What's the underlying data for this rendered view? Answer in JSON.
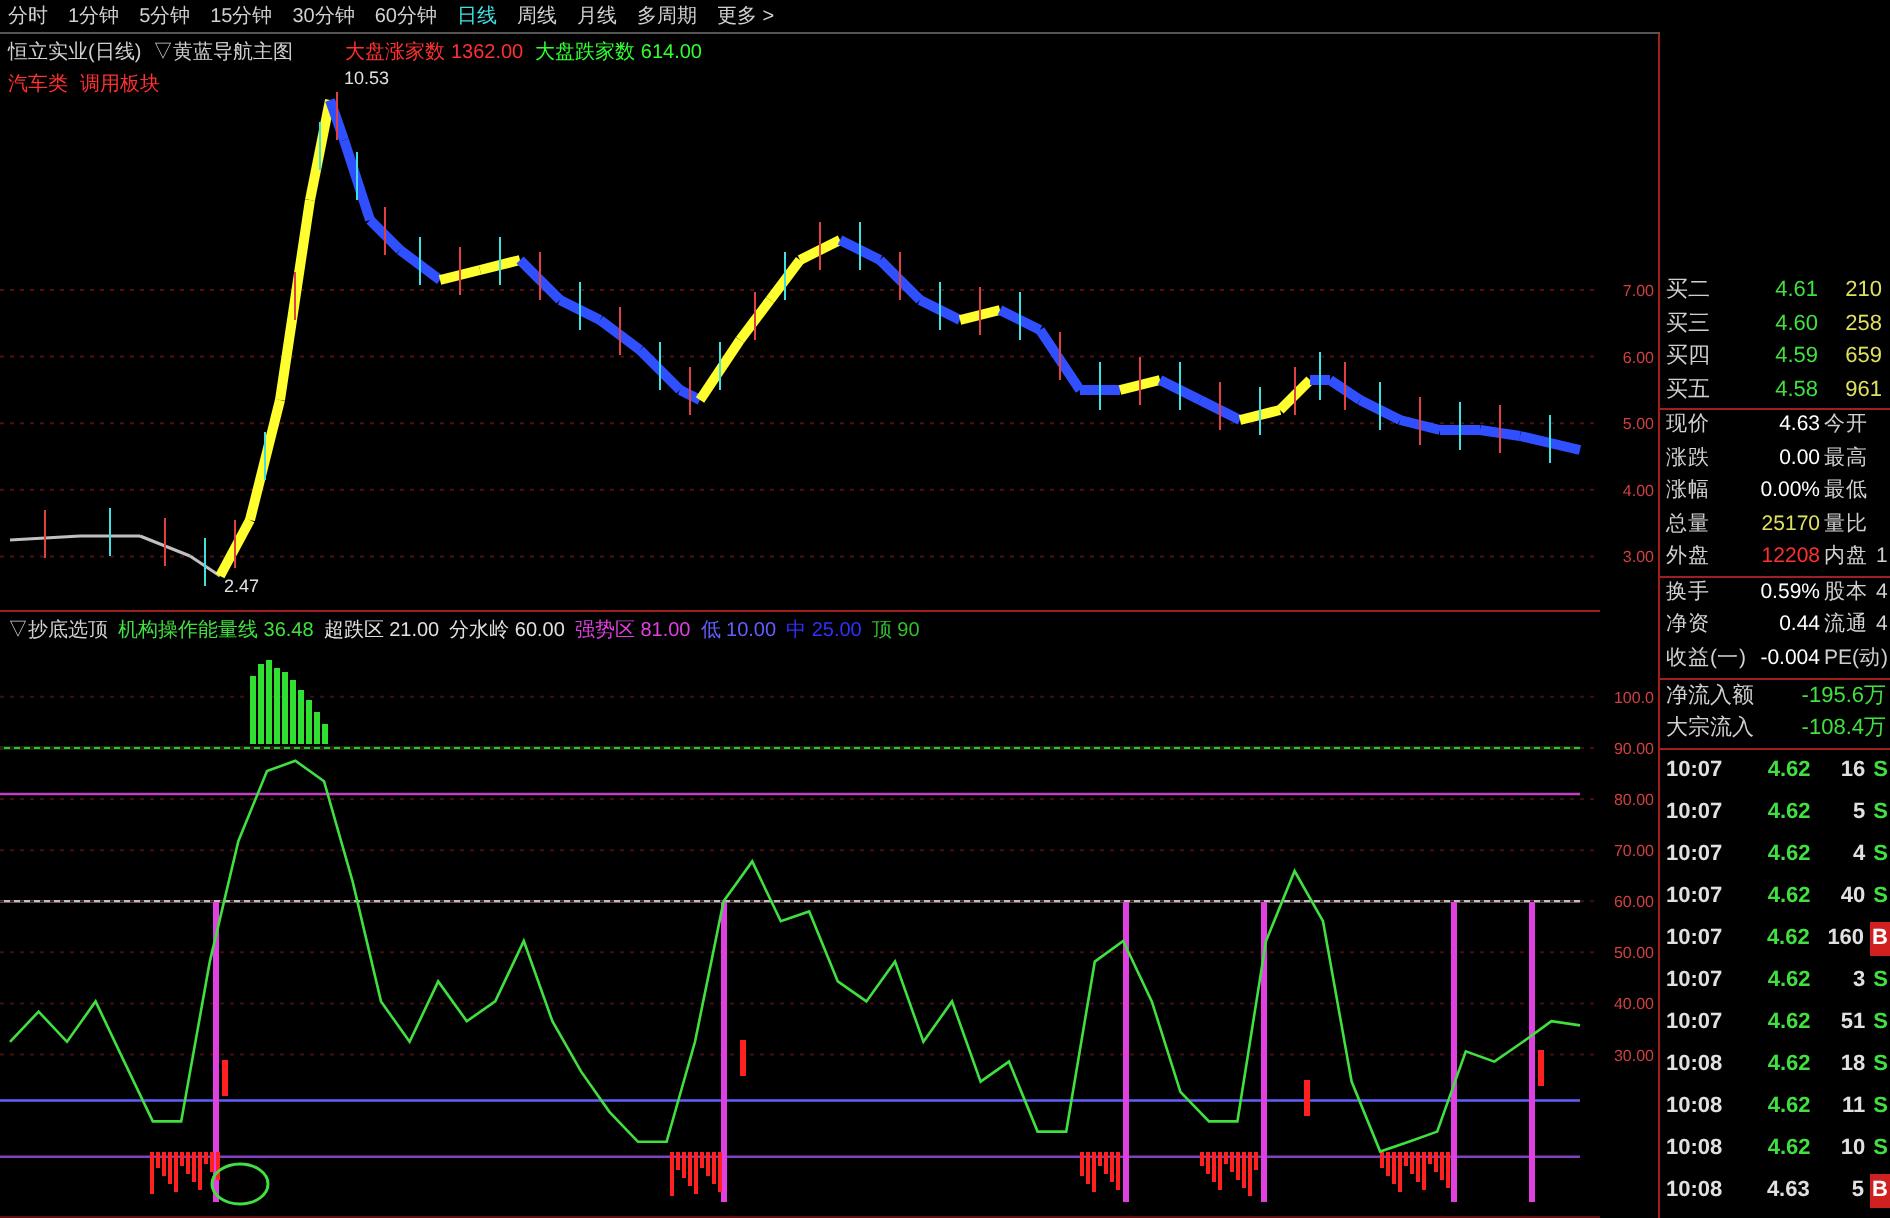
{
  "menu": [
    {
      "label": "分时",
      "selected": false
    },
    {
      "label": "1分钟",
      "selected": false
    },
    {
      "label": "5分钟",
      "selected": false
    },
    {
      "label": "15分钟",
      "selected": false
    },
    {
      "label": "30分钟",
      "selected": false
    },
    {
      "label": "60分钟",
      "selected": false
    },
    {
      "label": "日线",
      "selected": true
    },
    {
      "label": "周线",
      "selected": false
    },
    {
      "label": "月线",
      "selected": false
    },
    {
      "label": "多周期",
      "selected": false
    },
    {
      "label": "更多 >",
      "selected": false
    }
  ],
  "price_panel": {
    "title": "恒立实业(日线)",
    "indicator": "▽黄蓝导航主图",
    "legend": [
      {
        "label": "大盘涨家数",
        "value": "1362.00",
        "color": "#ff3030"
      },
      {
        "label": "大盘跌家数",
        "value": "614.00",
        "color": "#30ff30"
      }
    ],
    "subtitle": [
      "汽车类",
      "调用板块"
    ],
    "annotations": [
      "10.53",
      "2.47"
    ],
    "axis": [
      "7.00",
      "6.00",
      "5.00",
      "4.00",
      "3.00"
    ]
  },
  "indicator_panel": {
    "title": "▽抄底选顶",
    "line_value": "36.48",
    "lines": [
      {
        "label": "超跌区",
        "value": "21.00",
        "color": "#e0e0e0"
      },
      {
        "label": "分水岭",
        "value": "60.00",
        "color": "#e0e0e0"
      },
      {
        "label": "强势区",
        "value": "81.00",
        "color": "#e040e0"
      },
      {
        "label": "低",
        "value": "10.00",
        "color": "#6060ff"
      },
      {
        "label": "中",
        "value": "25.00",
        "color": "#3030ff"
      },
      {
        "label": "顶",
        "value": "90",
        "color": "#30c030"
      }
    ],
    "chart_data": {
      "type": "line",
      "ylim": [
        -2,
        117
      ],
      "grid": true,
      "series": [
        {
          "name": "机构操作能量线",
          "color": "#40e040",
          "values": [
            32.5,
            38.4,
            32.5,
            40.4,
            28.6,
            16.9,
            16.9,
            48.2,
            71.8,
            85.5,
            87.5,
            83.5,
            63.9,
            40.4,
            32.5,
            44.3,
            36.5,
            40.4,
            52.2,
            36.5,
            26.7,
            18.8,
            12.9,
            12.9,
            32.5,
            60,
            67.8,
            56.1,
            58,
            44.3,
            40.4,
            48.2,
            32.5,
            40.4,
            24.7,
            28.6,
            14.9,
            14.9,
            48.2,
            52.2,
            40.4,
            22.7,
            16.9,
            16.9,
            52.2,
            65.9,
            56.1,
            24.7,
            11,
            12.9,
            14.9,
            30.6,
            28.6,
            32.5,
            36.5,
            35.7
          ]
        }
      ],
      "yticks": [
        {
          "value": 100,
          "label": "100.0"
        },
        {
          "value": 90,
          "label": "90.00"
        },
        {
          "value": 80,
          "label": "80.00"
        },
        {
          "value": 70,
          "label": "70.00"
        },
        {
          "value": 60,
          "label": "60.00"
        },
        {
          "value": 50,
          "label": "50.00"
        },
        {
          "value": 40,
          "label": "40.00"
        },
        {
          "value": 30,
          "label": "30.00"
        }
      ]
    }
  },
  "quote": {
    "bids": [
      {
        "label": "买二",
        "price": "4.61",
        "volume": "210"
      },
      {
        "label": "买三",
        "price": "4.60",
        "volume": "258"
      },
      {
        "label": "买四",
        "price": "4.59",
        "volume": "659"
      },
      {
        "label": "买五",
        "price": "4.58",
        "volume": "961"
      }
    ],
    "stats": [
      {
        "label": "现价",
        "value": "4.63",
        "color": "#ffffff",
        "label2": "今开"
      },
      {
        "label": "涨跌",
        "value": "0.00",
        "color": "#ffffff",
        "label2": "最高"
      },
      {
        "label": "涨幅",
        "value": "0.00%",
        "color": "#ffffff",
        "label2": "最低"
      },
      {
        "label": "总量",
        "value": "25170",
        "color": "#e0e060",
        "label2": "量比"
      },
      {
        "label": "外盘",
        "value": "12208",
        "color": "#ff3030",
        "label2": "内盘",
        "value2": "1"
      },
      {
        "label": "换手",
        "value": "0.59%",
        "color": "#ffffff",
        "label2": "股本",
        "value2": "4"
      },
      {
        "label": "净资",
        "value": "0.44",
        "color": "#ffffff",
        "label2": "流通",
        "value2": "4"
      },
      {
        "label": "收益(一)",
        "value": "-0.004",
        "color": "#ffffff",
        "label2": "PE(动)"
      }
    ],
    "flows": [
      {
        "label": "净流入额",
        "value": "-195.6万"
      },
      {
        "label": "大宗流入",
        "value": "-108.4万"
      }
    ],
    "ticks": [
      {
        "time": "10:07",
        "price": "4.62",
        "volume": "16",
        "side": "S",
        "kind": "sell"
      },
      {
        "time": "10:07",
        "price": "4.62",
        "volume": "5",
        "side": "S",
        "kind": "sell"
      },
      {
        "time": "10:07",
        "price": "4.62",
        "volume": "4",
        "side": "S",
        "kind": "sell"
      },
      {
        "time": "10:07",
        "price": "4.62",
        "volume": "40",
        "side": "S",
        "kind": "sell"
      },
      {
        "time": "10:07",
        "price": "4.62",
        "volume": "160",
        "side": "B",
        "kind": "buy"
      },
      {
        "time": "10:07",
        "price": "4.62",
        "volume": "3",
        "side": "S",
        "kind": "sell"
      },
      {
        "time": "10:07",
        "price": "4.62",
        "volume": "51",
        "side": "S",
        "kind": "sell"
      },
      {
        "time": "10:08",
        "price": "4.62",
        "volume": "18",
        "side": "S",
        "kind": "sell"
      },
      {
        "time": "10:08",
        "price": "4.62",
        "volume": "11",
        "side": "S",
        "kind": "sell"
      },
      {
        "time": "10:08",
        "price": "4.62",
        "volume": "10",
        "side": "S",
        "kind": "sell"
      },
      {
        "time": "10:08",
        "price": "4.63",
        "volume": "5",
        "side": "B",
        "kind": "buy"
      }
    ]
  }
}
